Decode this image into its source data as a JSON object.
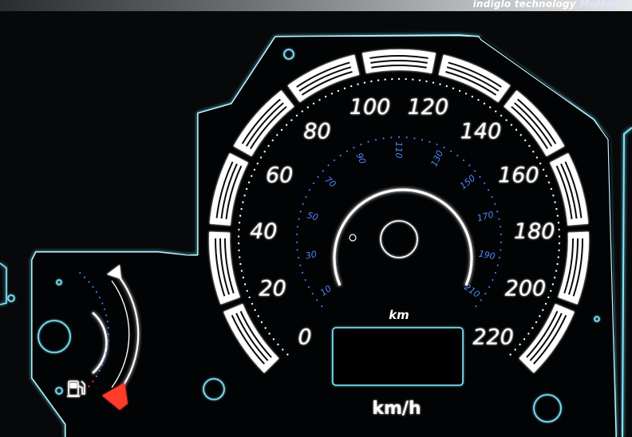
{
  "banner": {
    "brand_text": "indiglo technology",
    "brand_logo": "MoMan"
  },
  "speedometer": {
    "kmh_labels": [
      "0",
      "20",
      "40",
      "60",
      "80",
      "100",
      "120",
      "140",
      "160",
      "180",
      "200",
      "220"
    ],
    "mph_labels": [
      "10",
      "30",
      "50",
      "70",
      "90",
      "110",
      "130",
      "150",
      "170",
      "190",
      "210"
    ],
    "unit_label": "km/h",
    "odometer_label": "km"
  },
  "fuel_gauge": {
    "icon": "fuel-pump-icon"
  },
  "colors": {
    "glow": "#7ee8ff",
    "numerals": "#ffffff",
    "inner_scale": "#3f78ff",
    "warning": "#ff3a2a"
  }
}
